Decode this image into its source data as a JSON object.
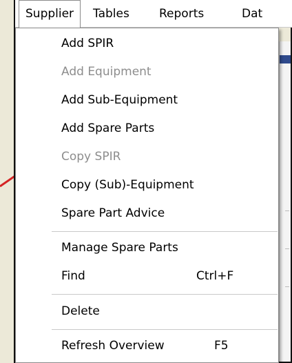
{
  "menubar": {
    "items": [
      "Supplier",
      "Tables",
      "Reports",
      "Dat"
    ]
  },
  "dropdown": {
    "items": [
      {
        "label": "Add SPIR",
        "enabled": true
      },
      {
        "label": "Add Equipment",
        "enabled": false
      },
      {
        "label": "Add Sub-Equipment",
        "enabled": true
      },
      {
        "label": "Add Spare Parts",
        "enabled": true
      },
      {
        "label": "Copy SPIR",
        "enabled": false
      },
      {
        "label": "Copy (Sub)-Equipment",
        "enabled": true
      },
      {
        "label": "Spare Part Advice",
        "enabled": true
      },
      {
        "label": "Manage Spare Parts",
        "enabled": true
      },
      {
        "label": "Find",
        "shortcut": "Ctrl+F",
        "enabled": true
      },
      {
        "label": "Delete",
        "enabled": true
      },
      {
        "label": "Refresh Overview",
        "shortcut": "F5",
        "enabled": true
      }
    ]
  },
  "colors": {
    "callout_line": "#d42424",
    "disabled_text": "#8d8d8d",
    "background": "#ece9d8"
  }
}
